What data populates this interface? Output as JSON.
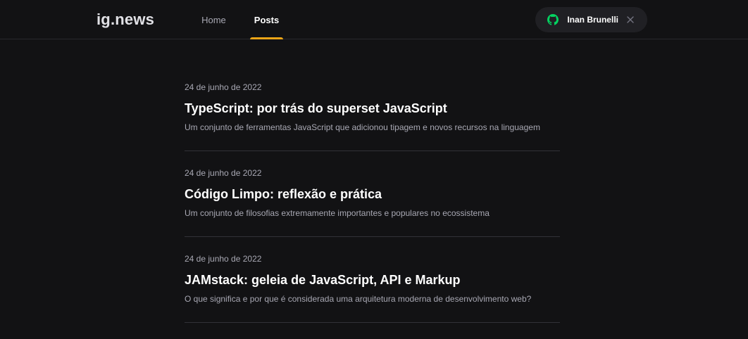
{
  "header": {
    "logo": "ig.news",
    "nav": [
      {
        "label": "Home",
        "active": false
      },
      {
        "label": "Posts",
        "active": true
      }
    ],
    "signin": {
      "icon": "github-icon",
      "icon_color": "#04d361",
      "user_name": "Inan Brunelli",
      "close_icon": "close-icon"
    }
  },
  "posts": [
    {
      "date": "24 de junho de 2022",
      "title": "TypeScript: por trás do superset JavaScript",
      "excerpt": "Um conjunto de ferramentas JavaScript que adicionou tipagem e novos recursos na linguagem"
    },
    {
      "date": "24 de junho de 2022",
      "title": "Código Limpo: reflexão e prática",
      "excerpt": "Um conjunto de filosofias extremamente importantes e populares no ecossistema"
    },
    {
      "date": "24 de junho de 2022",
      "title": "JAMstack: geleia de JavaScript, API e Markup",
      "excerpt": "O que significa e por que é considerada uma arquitetura moderna de desenvolvimento web?"
    }
  ],
  "colors": {
    "background": "#121214",
    "accent": "#eba417",
    "github": "#04d361"
  }
}
